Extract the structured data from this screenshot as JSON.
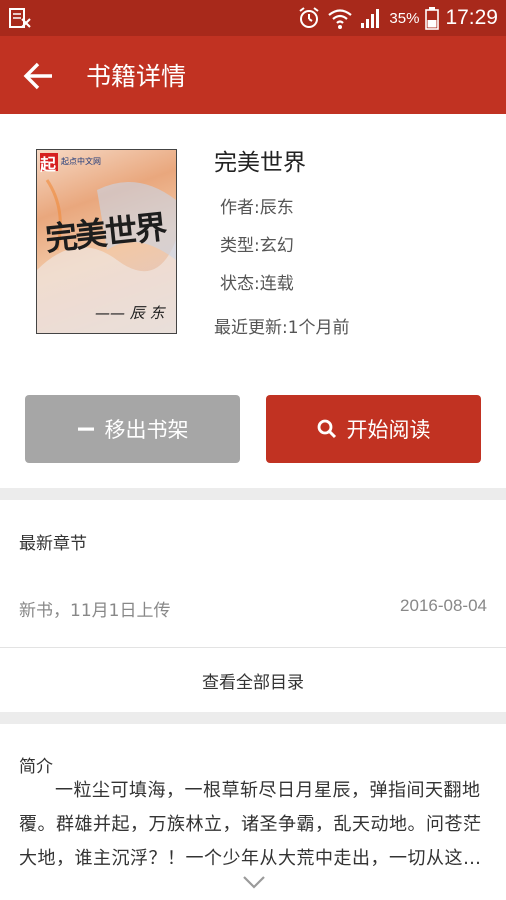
{
  "status_bar": {
    "battery": "35%",
    "time": "17:29",
    "icons": [
      "reader-notification-icon",
      "alarm-icon",
      "wifi-icon",
      "signal-icon",
      "battery-icon"
    ]
  },
  "app_bar": {
    "title": "书籍详情",
    "back_icon": "back-arrow-icon"
  },
  "book": {
    "title": "完美世界",
    "author": "作者:辰东",
    "genre": "类型:玄幻",
    "status": "状态:连载",
    "last_update": "最近更新:1个月前",
    "cover_text": {
      "badge": "起",
      "publisher": "起点中文网",
      "title": "完美世界",
      "author": "—— 辰 东"
    }
  },
  "actions": {
    "remove": "移出书架",
    "read": "开始阅读"
  },
  "latest_chapter": {
    "heading": "最新章节",
    "name": "新书，11月1日上传",
    "date": "2016-08-04",
    "view_all": "查看全部目录"
  },
  "intro": {
    "heading": "简介",
    "text": "一粒尘可填海，一根草斩尽日月星辰，弹指间天翻地覆。群雄并起，万族林立，诸圣争霸，乱天动地。问苍茫大地，谁主沉浮？！一个少年从大荒中走出，一切从这里开始……"
  },
  "colors": {
    "status_bar": "#a8291b",
    "app_bar": "#c13222",
    "read_button": "#c13222",
    "remove_button": "#a6a6a6",
    "divider": "#ececec"
  }
}
